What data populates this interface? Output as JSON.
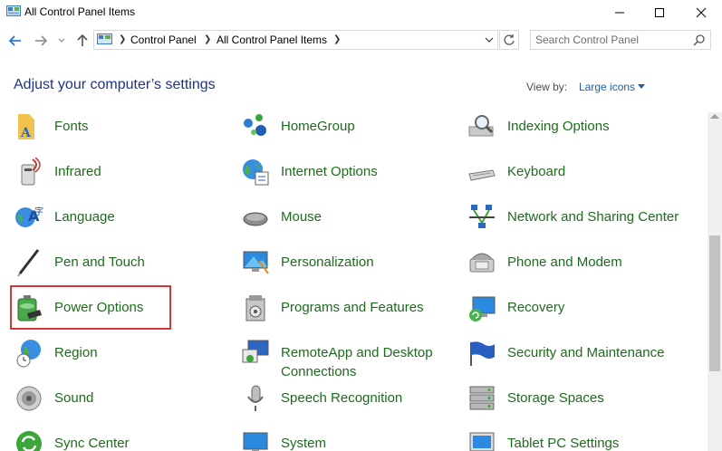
{
  "window": {
    "title": "All Control Panel Items"
  },
  "address_bar": {
    "breadcrumbs": [
      "Control Panel",
      "All Control Panel Items"
    ]
  },
  "search": {
    "placeholder": "Search Control Panel"
  },
  "header": {
    "title": "Adjust your computer’s settings",
    "view_by_label": "View by:",
    "view_by_value": "Large icons"
  },
  "items": {
    "fonts": "Fonts",
    "homegroup": "HomeGroup",
    "indexing": "Indexing Options",
    "infrared": "Infrared",
    "internet": "Internet Options",
    "keyboard": "Keyboard",
    "language": "Language",
    "mouse": "Mouse",
    "network": "Network and Sharing Center",
    "pen": "Pen and Touch",
    "personalization": "Personalization",
    "phone": "Phone and Modem",
    "power": "Power Options",
    "programs": "Programs and Features",
    "recovery": "Recovery",
    "region": "Region",
    "remoteapp": "RemoteApp and Desktop Connections",
    "security": "Security and Maintenance",
    "sound": "Sound",
    "speech": "Speech Recognition",
    "storage": "Storage Spaces",
    "sync": "Sync Center",
    "system": "System",
    "tablet": "Tablet PC Settings"
  },
  "colors": {
    "item_text": "#1e6b1e",
    "heading": "#1e3287",
    "highlight_border": "#d9343a",
    "link": "#1e5fa8"
  }
}
